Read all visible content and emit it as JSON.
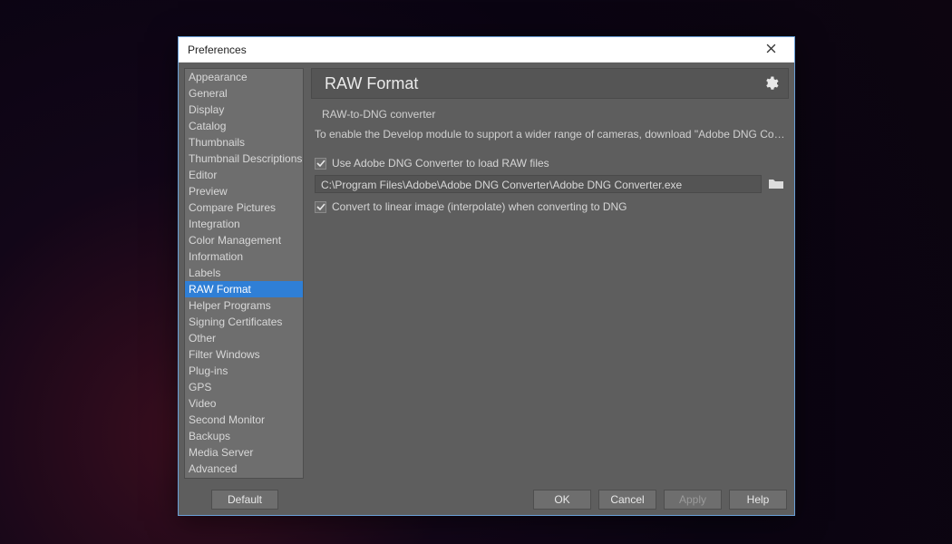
{
  "window": {
    "title": "Preferences"
  },
  "sidebar": {
    "items": [
      "Appearance",
      "General",
      "Display",
      "Catalog",
      "Thumbnails",
      "Thumbnail Descriptions",
      "Editor",
      "Preview",
      "Compare Pictures",
      "Integration",
      "Color Management",
      "Information",
      "Labels",
      "RAW Format",
      "Helper Programs",
      "Signing Certificates",
      "Other",
      "Filter Windows",
      "Plug-ins",
      "GPS",
      "Video",
      "Second Monitor",
      "Backups",
      "Media Server",
      "Advanced"
    ],
    "selected_index": 13
  },
  "panel": {
    "title": "RAW Format",
    "subheader": "RAW-to-DNG converter",
    "description": "To enable the Develop module to support a wider range of cameras, download \"Adobe DNG Convert...",
    "use_converter_label": "Use Adobe DNG Converter to load RAW files",
    "use_converter_checked": true,
    "path_value": "C:\\Program Files\\Adobe\\Adobe DNG Converter\\Adobe DNG Converter.exe",
    "convert_linear_label": "Convert to linear image (interpolate) when converting to DNG",
    "convert_linear_checked": true
  },
  "footer": {
    "default": "Default",
    "ok": "OK",
    "cancel": "Cancel",
    "apply": "Apply",
    "help": "Help",
    "apply_enabled": false
  }
}
